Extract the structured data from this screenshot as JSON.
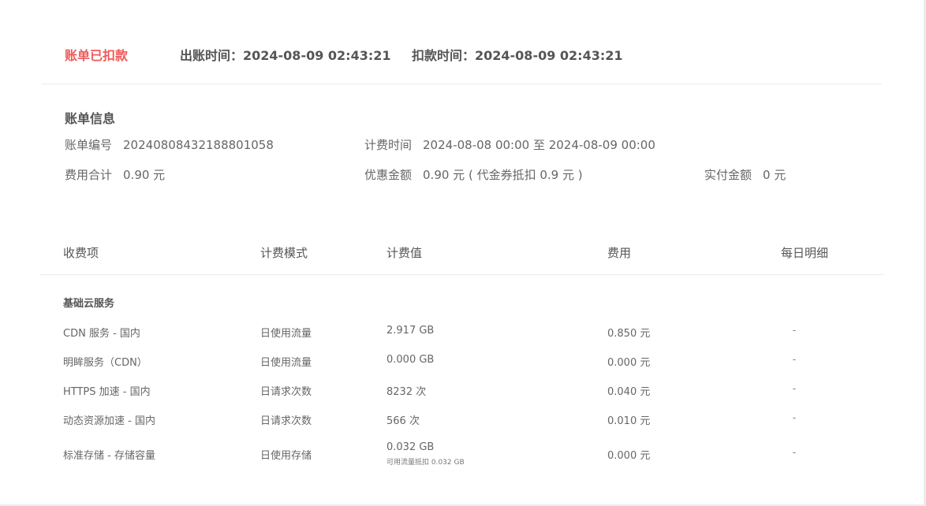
{
  "status": {
    "badge": "账单已扣款",
    "bill_time": "出账时间：2024-08-09 02:43:21",
    "deduct_time": "扣款时间：2024-08-09 02:43:21"
  },
  "bill_info": {
    "title": "账单信息",
    "bill_no_label": "账单编号",
    "bill_no_value": "20240808432188801058",
    "period_label": "计费时间",
    "period_value": "2024-08-08 00:00 至 2024-08-09 00:00",
    "total_label": "费用合计",
    "total_value": "0.90 元",
    "discount_label": "优惠金额",
    "discount_value": "0.90 元 ( 代金券抵扣 0.9 元 )",
    "paid_label": "实付金额",
    "paid_value": "0 元"
  },
  "table": {
    "headers": [
      "收费项",
      "计费模式",
      "计费值",
      "费用",
      "每日明细"
    ],
    "section_title": "基础云服务",
    "rows": [
      {
        "item": "CDN 服务 - 国内",
        "mode": "日使用流量",
        "value": "2.917 GB",
        "note": "",
        "fee": "0.850 元",
        "detail": "-"
      },
      {
        "item": "明眸服务（CDN）",
        "mode": "日使用流量",
        "value": "0.000 GB",
        "note": "",
        "fee": "0.000 元",
        "detail": "-"
      },
      {
        "item": "HTTPS 加速 - 国内",
        "mode": "日请求次数",
        "value": "8232 次",
        "note": "",
        "fee": "0.040 元",
        "detail": "-"
      },
      {
        "item": "动态资源加速 - 国内",
        "mode": "日请求次数",
        "value": "566 次",
        "note": "",
        "fee": "0.010 元",
        "detail": "-"
      },
      {
        "item": "标准存储 - 存储容量",
        "mode": "日使用存储",
        "value": "0.032 GB",
        "note": "可用流量抵扣 0.032 GB",
        "fee": "0.000 元",
        "detail": "-"
      }
    ]
  },
  "colors": {
    "status_red": "#ee5a5a",
    "text": "#555555",
    "divider": "#ececec"
  }
}
